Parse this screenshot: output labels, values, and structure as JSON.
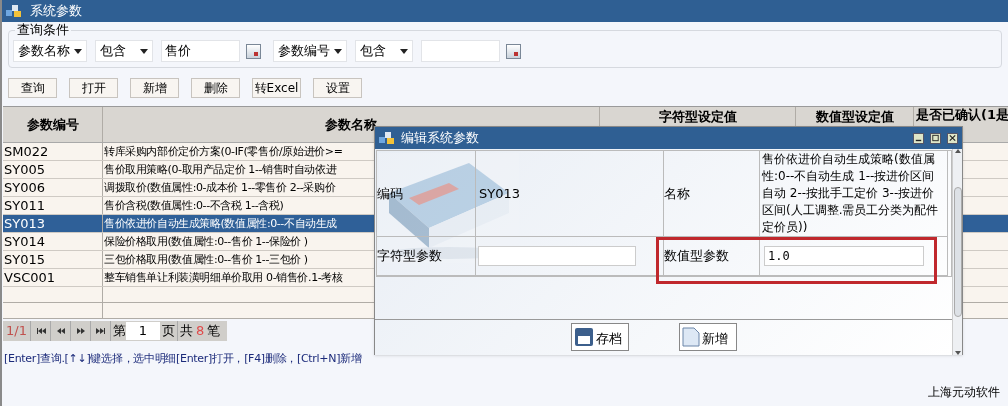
{
  "window": {
    "title": "系统参数"
  },
  "query": {
    "legend": "查询条件",
    "conditions": [
      {
        "field": "参数名称",
        "operator": "包含",
        "value": "售价"
      },
      {
        "field": "参数编号",
        "operator": "包含"
      }
    ]
  },
  "toolbar": [
    "查询",
    "打开",
    "新增",
    "删除",
    "转Excel",
    "设置"
  ],
  "table": {
    "columns": [
      "参数编号",
      "参数名称",
      "字符型设定值",
      "数值型设定值",
      "是否已确认(1是"
    ],
    "rows": [
      {
        "code": "SM022",
        "name": "转库采购内部价定价方案(0-IF(零售价/原始进价>=",
        "selected": false
      },
      {
        "code": "SY005",
        "name": "售价取用策略(0-取用产品定价 1--销售时自动依进",
        "selected": false
      },
      {
        "code": "SY006",
        "name": "调拨取价(数值属性:0-成本价 1--零售价 2--采购价",
        "selected": false
      },
      {
        "code": "SY011",
        "name": "售价含税(数值属性:0--不含税 1--含税)",
        "selected": false
      },
      {
        "code": "SY013",
        "name": "售价依进价自动生成策略(数值属性:0--不自动生成",
        "selected": true
      },
      {
        "code": "SY014",
        "name": "保险价格取用(数值属性:0--售价 1--保险价 )",
        "selected": false
      },
      {
        "code": "SY015",
        "name": "三包价格取用(数值属性:0--售价 1--三包价 )",
        "selected": false
      },
      {
        "code": "VSC001",
        "name": "整车销售单让利装潢明细单价取用 0-销售价.1-考核",
        "selected": false
      }
    ]
  },
  "pager": {
    "position": "1/1",
    "page_prefix": "第",
    "page": "1",
    "page_suffix": "页",
    "total_prefix": "共",
    "total": "8",
    "total_suffix": "笔"
  },
  "hint": "[Enter]查询.[↑↓]键选择，选中明细[Enter]打开，[F4]删除，[Ctrl+N]新增",
  "footer": "上海元动软件",
  "dialog": {
    "title": "编辑系统参数",
    "kind": "picture",
    "code_label": "编码",
    "code": "SY013",
    "name_label": "名称",
    "name": "售价依进价自动生成策略(数值属性:0--不自动生成 1--按进价区间自动 2--按批手工定价 3--按进价区间(人工调整.需员工分类为配件定价员))",
    "string_label": "字符型参数",
    "number_label": "数值型参数",
    "number_value": "1.0",
    "number_highlighted": true,
    "buttons": [
      {
        "kind": "save",
        "label": "存档"
      },
      {
        "kind": "new",
        "label": "新增"
      }
    ]
  }
}
